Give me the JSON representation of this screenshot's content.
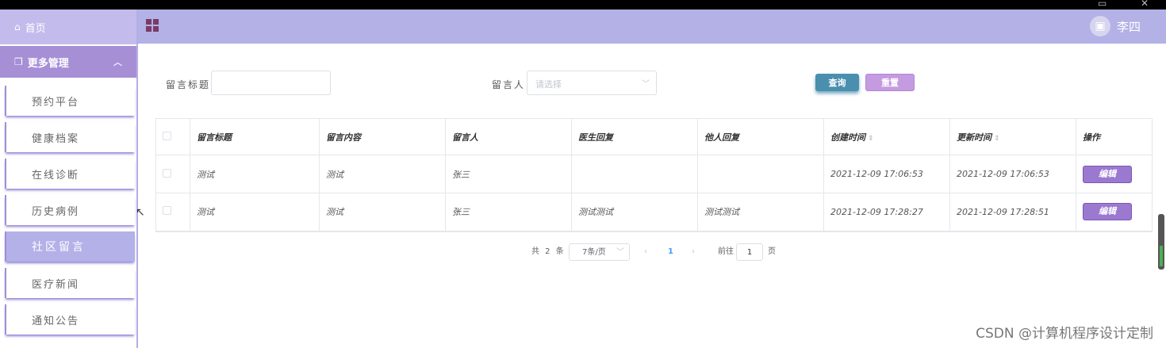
{
  "window": {
    "restore_icon": "restore-icon",
    "close_icon": "close-icon"
  },
  "sidebar": {
    "home": {
      "label": "首页",
      "icon": "home-icon"
    },
    "group": {
      "label": "更多管理",
      "icon": "copy-icon"
    },
    "items": [
      {
        "label": "预约平台"
      },
      {
        "label": "健康档案"
      },
      {
        "label": "在线诊断"
      },
      {
        "label": "历史病例"
      },
      {
        "label": "社区留言",
        "active": true
      },
      {
        "label": "医疗新闻"
      },
      {
        "label": "通知公告"
      }
    ]
  },
  "header": {
    "user_name": "李四"
  },
  "search": {
    "title_label": "留言标题",
    "title_value": "",
    "user_label": "留言人",
    "user_placeholder": "请选择",
    "search_button": "查询",
    "reset_button": "重置"
  },
  "table": {
    "columns": [
      "留言标题",
      "留言内容",
      "留言人",
      "医生回复",
      "他人回复",
      "创建时间",
      "更新时间",
      "操作"
    ],
    "rows": [
      [
        "测试",
        "测试",
        "张三",
        "",
        "",
        "2021-12-09 17:06:53",
        "2021-12-09 17:06:53"
      ],
      [
        "测试",
        "测试",
        "张三",
        "测试测试",
        "测试测试",
        "2021-12-09 17:28:27",
        "2021-12-09 17:28:51"
      ]
    ],
    "edit_label": "编辑"
  },
  "pagination": {
    "total": "共 2 条",
    "page_size": "7条/页",
    "current_page": "1",
    "goto_label": "前往",
    "goto_value": "1",
    "page_suffix": "页"
  },
  "watermark": "CSDN @计算机程序设计定制",
  "colors": {
    "sidebar_group": "#a78fd6",
    "header": "#b3b1e6",
    "search_btn": "#4a8fae",
    "edit_btn": "#9b79d0"
  }
}
